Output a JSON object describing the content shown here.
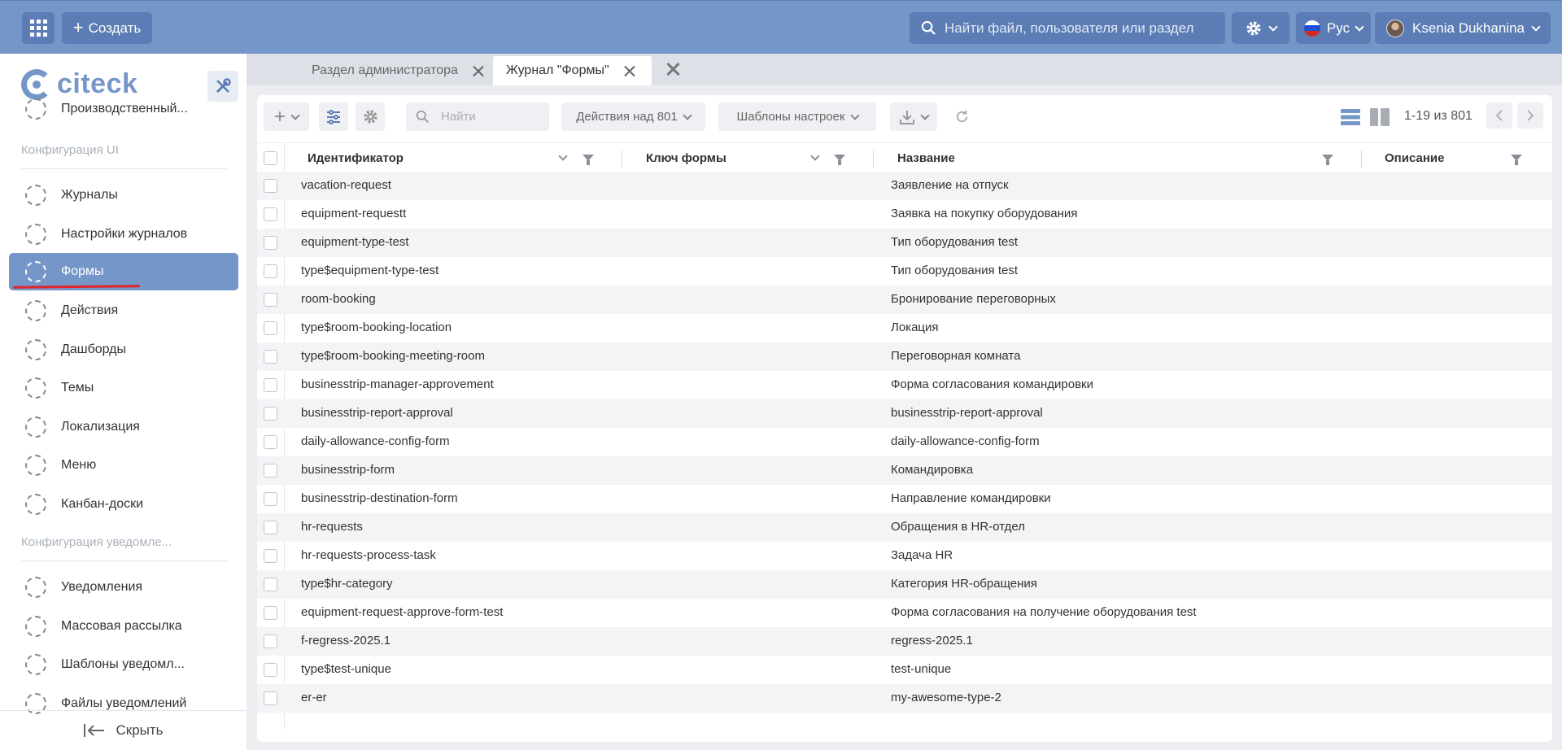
{
  "header": {
    "create_label": "Создать",
    "search_placeholder": "Найти файл, пользователя или раздел",
    "language": "Рус",
    "user_name": "Ksenia Dukhanina"
  },
  "sidebar": {
    "logo_text": "citeck",
    "top_item": "Производственный...",
    "section_ui": "Конфигурация UI",
    "items_ui": [
      "Журналы",
      "Настройки журналов",
      "Формы",
      "Действия",
      "Дашборды",
      "Темы",
      "Локализация",
      "Меню",
      "Канбан-доски"
    ],
    "active_item": "Формы",
    "section_notify": "Конфигурация уведомле...",
    "items_notify": [
      "Уведомления",
      "Массовая рассылка",
      "Шаблоны уведомл...",
      "Файлы уведомлений"
    ],
    "collapse_label": "Скрыть"
  },
  "tabs": [
    {
      "label": "Раздел администратора",
      "active": false
    },
    {
      "label": "Журнал \"Формы\"",
      "active": true
    }
  ],
  "toolbar": {
    "search_placeholder": "Найти",
    "actions_label": "Действия над 801",
    "templates_label": "Шаблоны настроек",
    "pager": "1-19 из 801"
  },
  "table": {
    "columns": [
      "Идентификатор",
      "Ключ формы",
      "Название",
      "Описание"
    ],
    "rows": [
      {
        "id": "vacation-request",
        "name": "Заявление на отпуск"
      },
      {
        "id": "equipment-requestt",
        "name": "Заявка на покупку оборудования"
      },
      {
        "id": "equipment-type-test",
        "name": "Тип оборудования test"
      },
      {
        "id": "type$equipment-type-test",
        "name": "Тип оборудования test"
      },
      {
        "id": "room-booking",
        "name": "Бронирование переговорных"
      },
      {
        "id": "type$room-booking-location",
        "name": "Локация"
      },
      {
        "id": "type$room-booking-meeting-room",
        "name": "Переговорная комната"
      },
      {
        "id": "businesstrip-manager-approvement",
        "name": "Форма согласования командировки"
      },
      {
        "id": "businesstrip-report-approval",
        "name": "businesstrip-report-approval"
      },
      {
        "id": "daily-allowance-config-form",
        "name": "daily-allowance-config-form"
      },
      {
        "id": "businesstrip-form",
        "name": "Командировка"
      },
      {
        "id": "businesstrip-destination-form",
        "name": "Направление командировки"
      },
      {
        "id": "hr-requests",
        "name": "Обращения в HR-отдел"
      },
      {
        "id": "hr-requests-process-task",
        "name": "Задача HR"
      },
      {
        "id": "type$hr-category",
        "name": "Категория HR-обращения"
      },
      {
        "id": "equipment-request-approve-form-test",
        "name": "Форма согласования на получение оборудования test"
      },
      {
        "id": "f-regress-2025.1",
        "name": "regress-2025.1"
      },
      {
        "id": "type$test-unique",
        "name": "test-unique"
      },
      {
        "id": "er-er",
        "name": "my-awesome-type-2"
      }
    ]
  },
  "colors": {
    "header": "#7596c8",
    "header_button": "#5b7cb4",
    "active_item": "#7596c8",
    "underline": "#e0262b"
  }
}
